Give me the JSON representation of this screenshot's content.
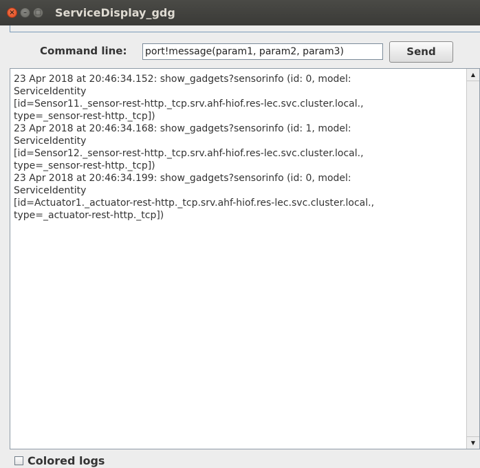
{
  "window": {
    "title": "ServiceDisplay_gdg",
    "close_glyph": "×",
    "min_glyph": "–",
    "max_glyph": "□"
  },
  "command": {
    "label": "Command line:",
    "value": "port!message(param1, param2, param3)",
    "send_label": "Send"
  },
  "log": {
    "lines": [
      "23 Apr 2018 at 20:46:34.152: show_gadgets?sensorinfo (id: 0, model:",
      "ServiceIdentity",
      "[id=Sensor11._sensor-rest-http._tcp.srv.ahf-hiof.res-lec.svc.cluster.local.,",
      "type=_sensor-rest-http._tcp])",
      "23 Apr 2018 at 20:46:34.168: show_gadgets?sensorinfo (id: 1, model:",
      "ServiceIdentity",
      "[id=Sensor12._sensor-rest-http._tcp.srv.ahf-hiof.res-lec.svc.cluster.local.,",
      "type=_sensor-rest-http._tcp])",
      "23 Apr 2018 at 20:46:34.199: show_gadgets?sensorinfo (id: 0, model:",
      "ServiceIdentity",
      "[id=Actuator1._actuator-rest-http._tcp.srv.ahf-hiof.res-lec.svc.cluster.local.,",
      "type=_actuator-rest-http._tcp])"
    ]
  },
  "scroll": {
    "up_glyph": "▲",
    "down_glyph": "▼"
  },
  "options": {
    "colored_logs_label": "Colored logs",
    "colored_logs_checked": false
  },
  "colors": {
    "titlebar": "#3c3b37",
    "close_button": "#e95420",
    "border": "#8e9aa6"
  }
}
